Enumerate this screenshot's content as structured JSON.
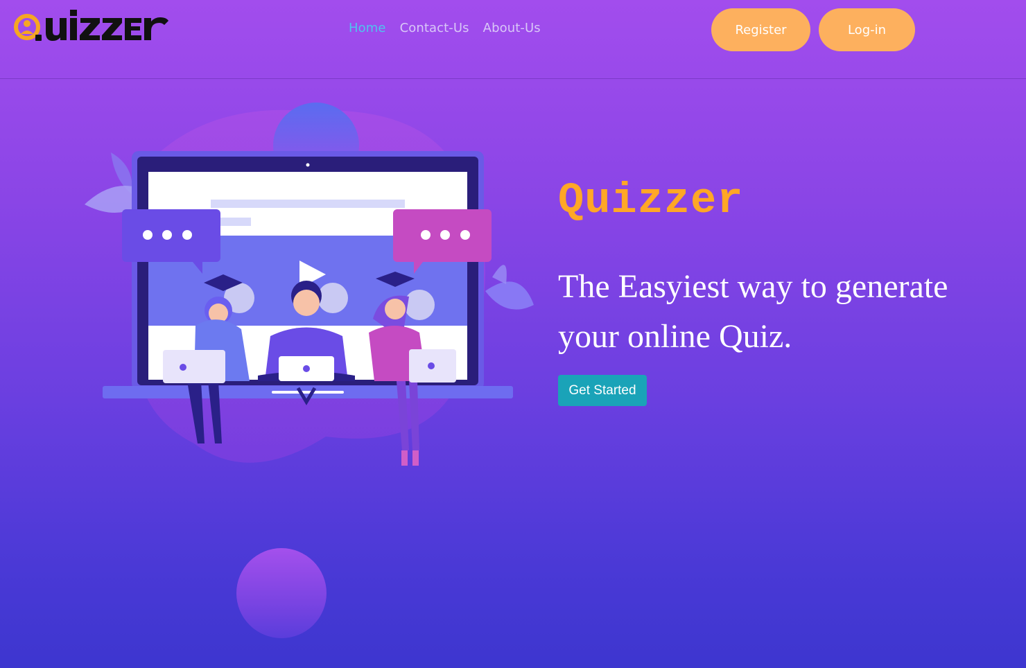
{
  "brand": {
    "logo_text": "Quizzer",
    "logo_alt": "Quizzer logo"
  },
  "nav": {
    "links": [
      {
        "label": "Home",
        "active": true
      },
      {
        "label": "Contact-Us",
        "active": false
      },
      {
        "label": "About-Us",
        "active": false
      }
    ],
    "register_label": "Register",
    "login_label": "Log-in"
  },
  "hero": {
    "title": "Quizzer",
    "tagline": "The Easyiest way to generate your online Quiz.",
    "cta_label": "Get Started",
    "illustration": "students-with-laptops-illustration"
  },
  "colors": {
    "accent_orange": "#ffa726",
    "button_orange": "#fdb05e",
    "cta_teal": "#1aa3b8",
    "nav_active": "#4fc3ef",
    "bg_top": "#a24ded",
    "bg_bottom": "#3d36cf"
  }
}
